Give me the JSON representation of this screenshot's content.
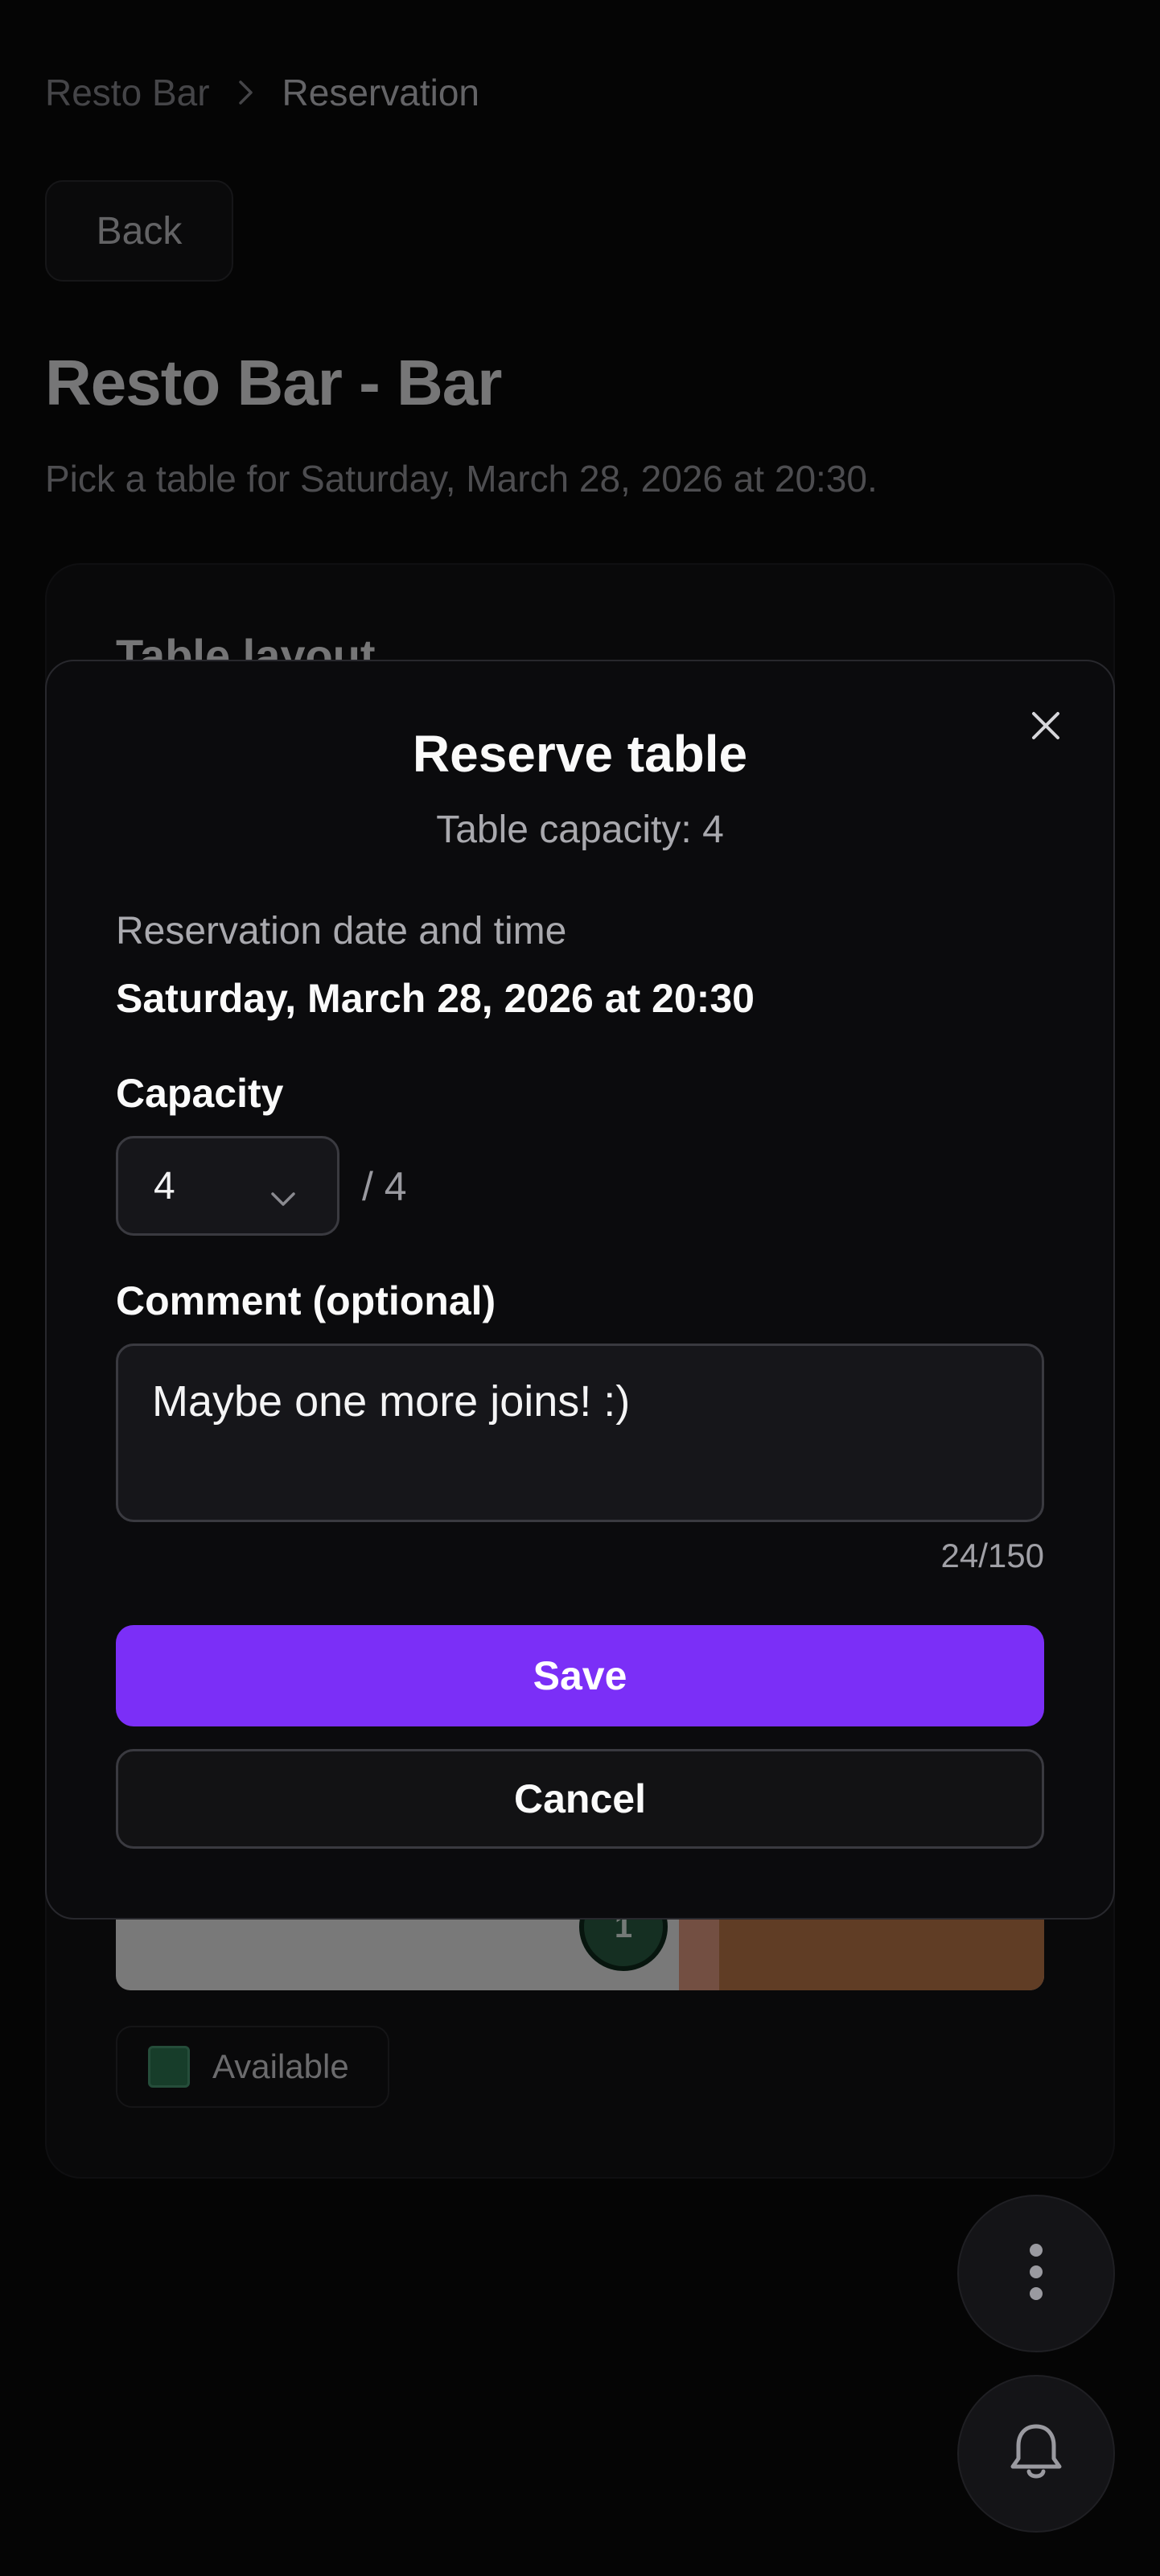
{
  "breadcrumb": {
    "root": "Resto Bar",
    "current": "Reservation"
  },
  "back_label": "Back",
  "page": {
    "title": "Resto Bar - Bar",
    "subtitle": "Pick a table for Saturday, March 28, 2026 at 20:30."
  },
  "layout_card": {
    "title": "Table layout",
    "table_number": "1",
    "legend": {
      "label": "Available",
      "color": "#2f7a55"
    }
  },
  "modal": {
    "title": "Reserve table",
    "subtitle": "Table capacity: 4",
    "datetime_label": "Reservation date and time",
    "datetime_value": "Saturday, March 28, 2026 at 20:30",
    "capacity_label": "Capacity",
    "capacity_value": "4",
    "capacity_max": "/ 4",
    "comment_label": "Comment (optional)",
    "comment_value": "Maybe one more joins! :)",
    "comment_counter": "24/150",
    "save_label": "Save",
    "cancel_label": "Cancel"
  },
  "colors": {
    "accent": "#7b2ff7",
    "available": "#2f7a55"
  },
  "icons": {
    "breadcrumb_sep": "chevron-right-icon",
    "close": "close-icon",
    "select": "chevron-down-icon",
    "fab_menu": "more-vertical-icon",
    "fab_bell": "bell-icon"
  }
}
